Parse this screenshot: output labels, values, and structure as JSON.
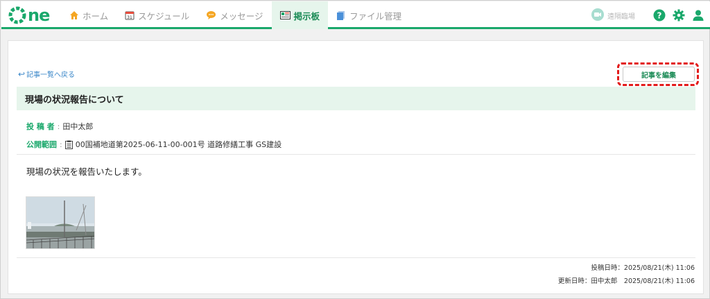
{
  "app": {
    "logo_text": "ne",
    "brand_color": "#1aa86b"
  },
  "nav": {
    "items": [
      {
        "label": "ホーム",
        "icon": "home-icon",
        "active": false
      },
      {
        "label": "スケジュール",
        "icon": "calendar-icon",
        "active": false
      },
      {
        "label": "メッセージ",
        "icon": "message-icon",
        "active": false
      },
      {
        "label": "掲示板",
        "icon": "board-icon",
        "active": true
      },
      {
        "label": "ファイル管理",
        "icon": "files-icon",
        "active": false
      }
    ],
    "calendar_day": "31"
  },
  "header_right": {
    "remote_label": "遠隔臨場"
  },
  "post": {
    "back_label": "記事一覧へ戻る",
    "edit_label": "記事を編集",
    "title": "現場の状況報告について",
    "author_label": "投 稿 者",
    "author": "田中太郎",
    "scope_label": "公開範囲",
    "scope": "00国補地道第2025-06-11-00-001号 道路修繕工事 GS建設",
    "body": "現場の状況を報告いたします。",
    "posted_at": "投稿日時：2025/08/21(木) 11:06",
    "updated_at": "更新日時：田中太郎　2025/08/21(木) 11:06"
  },
  "colors": {
    "accent": "#1aa86b",
    "highlight": "#e31b1b",
    "link": "#3a87c8"
  }
}
